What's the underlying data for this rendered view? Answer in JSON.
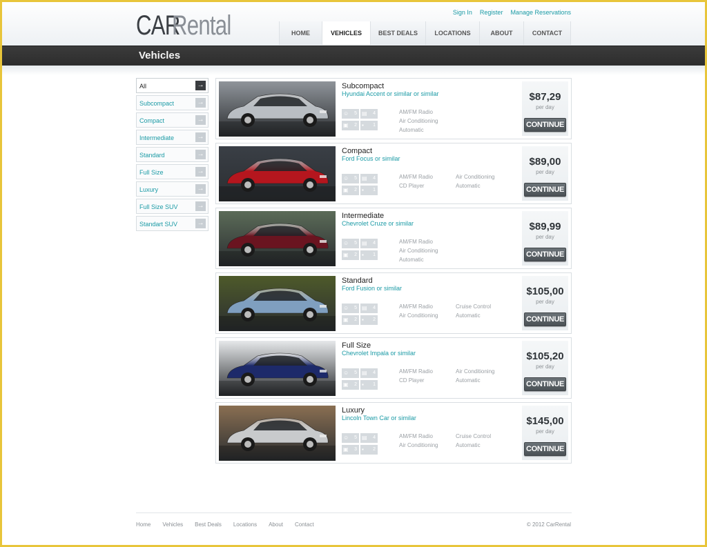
{
  "header": {
    "logo_part1": "CAR",
    "logo_part2": "Rental",
    "toplinks": [
      "Sign In",
      "Register",
      "Manage Reservations"
    ],
    "nav": [
      "HOME",
      "VEHICLES",
      "BEST DEALS",
      "LOCATIONS",
      "ABOUT",
      "CONTACT"
    ],
    "active_nav": "VEHICLES"
  },
  "page_title": "Vehicles",
  "sidebar": {
    "items": [
      "All",
      "Subcompact",
      "Compact",
      "Intermediate",
      "Standard",
      "Full Size",
      "Luxury",
      "Full Size SUV",
      "Standart SUV"
    ],
    "active": "All",
    "arrow": "→"
  },
  "vehicles": [
    {
      "class": "Subcompact",
      "model": "Hyundai Accent or similar  or similar",
      "passengers": "5",
      "doors": "4",
      "large_bags": "2",
      "small_bags": "1",
      "features": [
        "AM/FM Radio",
        "Air Conditioning",
        "Automatic"
      ],
      "features2": [],
      "price": "$87,29",
      "per": "per day",
      "button": "CONTINUE",
      "car_color": "#b9bec3",
      "bg_color": "#8f949a"
    },
    {
      "class": "Compact",
      "model": "Ford Focus or similar",
      "passengers": "5",
      "doors": "4",
      "large_bags": "2",
      "small_bags": "1",
      "features": [
        "AM/FM Radio",
        "CD Player"
      ],
      "features2": [
        "Air Conditioning",
        "Automatic"
      ],
      "price": "$89,00",
      "per": "per day",
      "button": "CONTINUE",
      "car_color": "#b5161e",
      "bg_color": "#3a3f46"
    },
    {
      "class": "Intermediate",
      "model": "Chevrolet Cruze or similar",
      "passengers": "5",
      "doors": "4",
      "large_bags": "2",
      "small_bags": "1",
      "features": [
        "AM/FM Radio",
        "Air Conditioning",
        "Automatic"
      ],
      "features2": [],
      "price": "$89,99",
      "per": "per day",
      "button": "CONTINUE",
      "car_color": "#6a1420",
      "bg_color": "#5b6b58"
    },
    {
      "class": "Standard",
      "model": "Ford Fusion or similar",
      "passengers": "5",
      "doors": "4",
      "large_bags": "2",
      "small_bags": "2",
      "features": [
        "AM/FM Radio",
        "Air Conditioning"
      ],
      "features2": [
        "Cruise Control",
        "Automatic"
      ],
      "price": "$105,00",
      "per": "per day",
      "button": "CONTINUE",
      "car_color": "#7f9fbf",
      "bg_color": "#4e5a2a"
    },
    {
      "class": "Full Size",
      "model": "Chevrolet Impala or similar",
      "passengers": "5",
      "doors": "4",
      "large_bags": "2",
      "small_bags": "1",
      "features": [
        "AM/FM Radio",
        "CD Player"
      ],
      "features2": [
        "Air Conditioning",
        "Automatic"
      ],
      "price": "$105,20",
      "per": "per day",
      "button": "CONTINUE",
      "car_color": "#1d2a6a",
      "bg_color": "#e6e8ea"
    },
    {
      "class": "Luxury",
      "model": "Lincoln Town Car or similar",
      "passengers": "5",
      "doors": "4",
      "large_bags": "3",
      "small_bags": "2",
      "features": [
        "AM/FM Radio",
        "Air Conditioning"
      ],
      "features2": [
        "Cruise Control",
        "Automatic"
      ],
      "price": "$145,00",
      "per": "per day",
      "button": "CONTINUE",
      "car_color": "#c8cacc",
      "bg_color": "#8a6f52"
    }
  ],
  "footer": {
    "links": [
      "Home",
      "Vehicles",
      "Best Deals",
      "Locations",
      "About",
      "Contact"
    ],
    "copyright": "© 2012 CarRental"
  },
  "colors": {
    "accent": "#1a9aa5",
    "band": "#333333",
    "frame": "#e8c53a"
  }
}
